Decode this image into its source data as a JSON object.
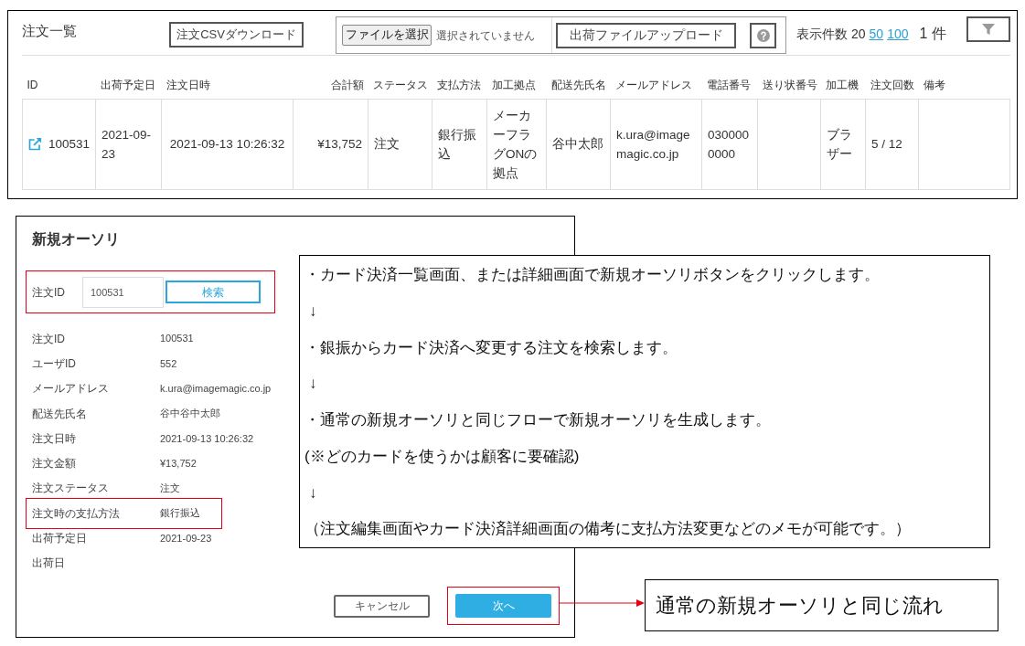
{
  "order_list": {
    "title": "注文一覧",
    "csv_button": "注文CSVダウンロード",
    "file_upload": {
      "choose_button": "ファイルを選択",
      "status": "選択されていません",
      "upload_button": "出荷ファイルアップロード"
    },
    "page_size": {
      "label": "表示件数",
      "options": [
        {
          "label": "20",
          "selected": true
        },
        {
          "label": "50",
          "selected": false
        },
        {
          "label": "100",
          "selected": false
        }
      ]
    },
    "count": "1 件",
    "columns": [
      "ID",
      "出荷予定日",
      "注文日時",
      "合計額",
      "ステータス",
      "支払方法",
      "加工拠点",
      "配送先氏名",
      "メールアドレス",
      "電話番号",
      "送り状番号",
      "加工機",
      "注文回数",
      "備考"
    ],
    "rows": [
      {
        "id": "100531",
        "ship_date": "2021-09-23",
        "ordered_at": "2021-09-13 10:26:32",
        "total": "¥13,752",
        "status": "注文",
        "payment_method": "銀行振込",
        "processing_site": "メーカーフラグONの拠点",
        "recipient": "谷中太郎",
        "email": "k.ura@imagemagic.co.jp",
        "phone": "0300000000",
        "machine": "ブラザー",
        "order_count": "5 / 12"
      }
    ]
  },
  "auth_dialog": {
    "title": "新規オーソリ",
    "search": {
      "label": "注文ID",
      "value": "100531",
      "button": "検索",
      "highlighted": true
    },
    "details": [
      {
        "label": "注文ID",
        "value": "100531",
        "highlighted": false
      },
      {
        "label": "ユーザID",
        "value": "552",
        "highlighted": false
      },
      {
        "label": "メールアドレス",
        "value": "k.ura@imagemagic.co.jp",
        "highlighted": false
      },
      {
        "label": "配送先氏名",
        "value": "谷中谷中太郎",
        "highlighted": false
      },
      {
        "label": "注文日時",
        "value": "2021-09-13 10:26:32",
        "highlighted": false
      },
      {
        "label": "注文金額",
        "value": "¥13,752",
        "highlighted": false
      },
      {
        "label": "注文ステータス",
        "value": "注文",
        "highlighted": false
      },
      {
        "label": "注文時の支払方法",
        "value": "銀行振込",
        "highlighted": true
      },
      {
        "label": "出荷予定日",
        "value": "2021-09-23",
        "highlighted": false
      },
      {
        "label": "出荷日",
        "highlighted": false
      }
    ],
    "buttons": [
      {
        "label": "キャンセル",
        "kind": "secondary",
        "highlighted": false
      },
      {
        "label": "次へ",
        "kind": "primary",
        "highlighted": true
      }
    ]
  },
  "note": {
    "lines": [
      {
        "kind": "text",
        "text": "・カード決済一覧画面、または詳細画面で新規オーソリボタンをクリックします。"
      },
      {
        "kind": "arrow",
        "text": "↓"
      },
      {
        "kind": "text",
        "text": "・銀振からカード決済へ変更する注文を検索します。"
      },
      {
        "kind": "arrow",
        "text": "↓"
      },
      {
        "kind": "text",
        "text": "・通常の新規オーソリと同じフローで新規オーソリを生成します。"
      },
      {
        "kind": "text",
        "text": "(※どのカードを使うかは顧客に要確認)"
      },
      {
        "kind": "arrow",
        "text": "↓"
      },
      {
        "kind": "text",
        "text": "（注文編集画面やカード決済詳細画面の備考に支払方法変更などのメモが可能です。）"
      }
    ]
  },
  "callout": {
    "text": "通常の新規オーソリと同じ流れ"
  }
}
